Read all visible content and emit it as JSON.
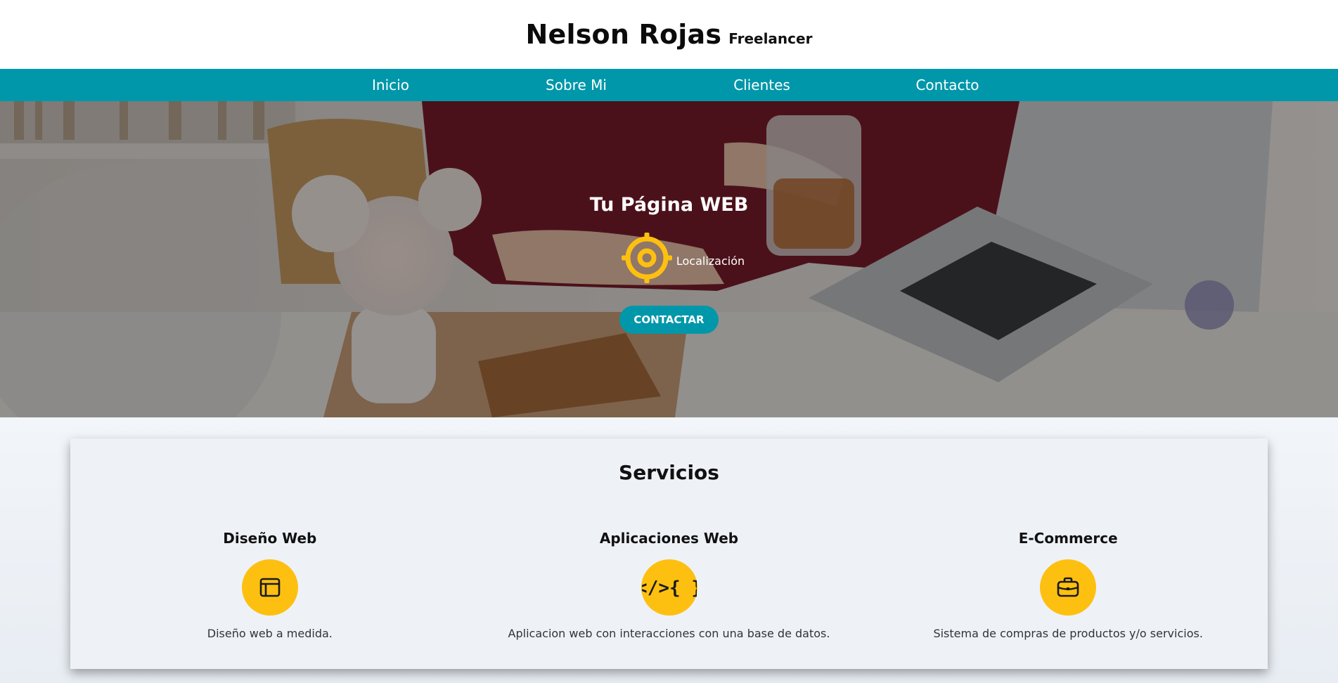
{
  "brand": {
    "name": "Nelson Rojas",
    "tagline": "Freelancer"
  },
  "nav": {
    "items": [
      {
        "label": "Inicio"
      },
      {
        "label": "Sobre Mi"
      },
      {
        "label": "Clientes"
      },
      {
        "label": "Contacto"
      }
    ]
  },
  "hero": {
    "title": "Tu Página WEB",
    "location_label": "Localización",
    "location_icon": "target-location-icon",
    "cta_label": "CONTACTAR"
  },
  "services": {
    "title": "Servicios",
    "items": [
      {
        "title": "Diseño Web",
        "icon": "browser-window-icon",
        "description": "Diseño web a medida."
      },
      {
        "title": "Aplicaciones Web",
        "icon": "code-braces-icon",
        "description": "Aplicacion web con interacciones con una base de datos."
      },
      {
        "title": "E-Commerce",
        "icon": "briefcase-icon",
        "description": "Sistema de compras de productos y/o servicios."
      }
    ]
  },
  "colors": {
    "accent": "#0097aa",
    "icon_yellow": "#fdc010",
    "header_bg": "#ffffff",
    "page_bg": "#eef2f7"
  }
}
